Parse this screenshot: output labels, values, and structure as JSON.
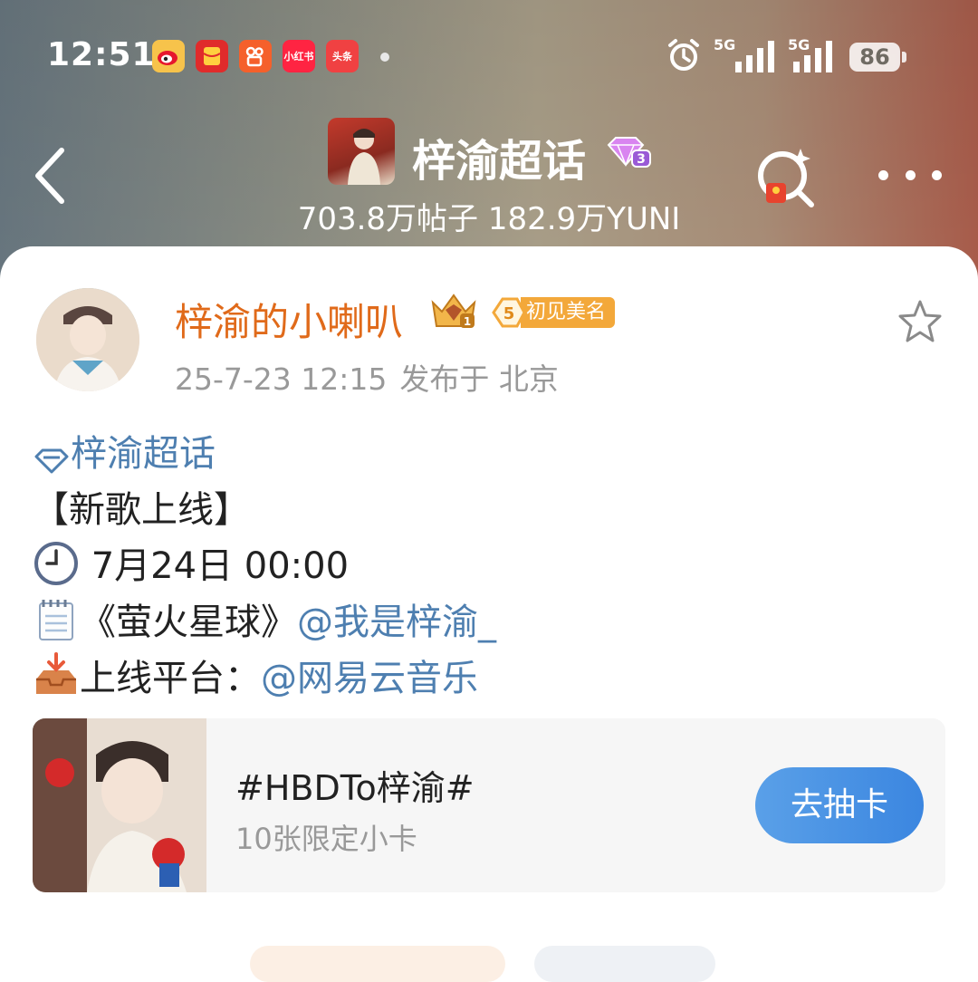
{
  "status_bar": {
    "time": "12:51",
    "apps": [
      {
        "icon": "weibo-icon",
        "label": "",
        "color": "#f7c34b"
      },
      {
        "icon": "red-envelope-icon",
        "label": "",
        "color": "#e02b2b"
      },
      {
        "icon": "kuaishou-icon",
        "label": "",
        "color": "#f5602b"
      },
      {
        "icon": "xiaohongshu-icon",
        "label": "小红书",
        "color": "#ff2442"
      },
      {
        "icon": "toutiao-icon",
        "label": "头条",
        "color": "#f04142"
      }
    ],
    "network_1": "5G",
    "network_2": "5G",
    "battery": "86"
  },
  "header": {
    "title": "梓渝超话",
    "level": "3",
    "stats": "703.8万帖子 182.9万YUNI"
  },
  "post": {
    "username": "梓渝的小喇叭",
    "crown_level": "1",
    "badge_level": "5",
    "badge_text": "初见美名",
    "date": "25-7-23 12:15",
    "location": "发布于 北京",
    "lines": {
      "topic": "梓渝超话",
      "heading": "【新歌上线】",
      "time_text": "7月24日 00:00",
      "song": "《萤火星球》",
      "mention_artist": "@我是梓渝_",
      "platform_label": "上线平台：",
      "mention_platform": "@网易云音乐"
    }
  },
  "hashtag_card": {
    "title": "#HBDTo梓渝#",
    "subtitle": "10张限定小卡",
    "button": "去抽卡"
  },
  "colors": {
    "username": "#e06a1a",
    "link": "#4e7fb0",
    "button": "#3b86e0"
  }
}
